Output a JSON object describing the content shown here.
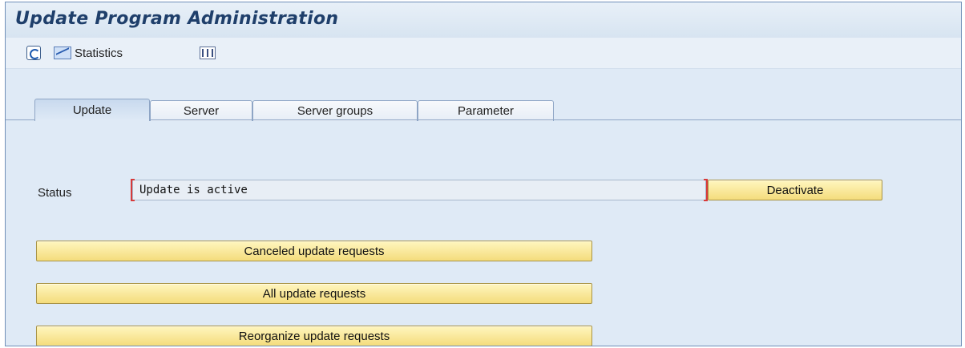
{
  "window": {
    "title": "Update Program Administration"
  },
  "toolbar": {
    "refresh_icon": "refresh-icon",
    "statistics_label": "Statistics",
    "statistics_icon": "chart-icon",
    "columns_icon": "columns-icon"
  },
  "tabs": [
    {
      "label": "Update",
      "active": true
    },
    {
      "label": "Server",
      "active": false
    },
    {
      "label": "Server groups",
      "active": false
    },
    {
      "label": "Parameter",
      "active": false
    }
  ],
  "status": {
    "label": "Status",
    "value": "Update is active",
    "action_label": "Deactivate"
  },
  "actions": {
    "canceled": "Canceled update requests",
    "all": "All update requests",
    "reorganize": "Reorganize update requests"
  },
  "colors": {
    "button_yellow": "#f4dc7c",
    "panel_blue": "#dfeaf6",
    "title_blue": "#1f3f6b",
    "bracket_red": "#d83a3a"
  }
}
